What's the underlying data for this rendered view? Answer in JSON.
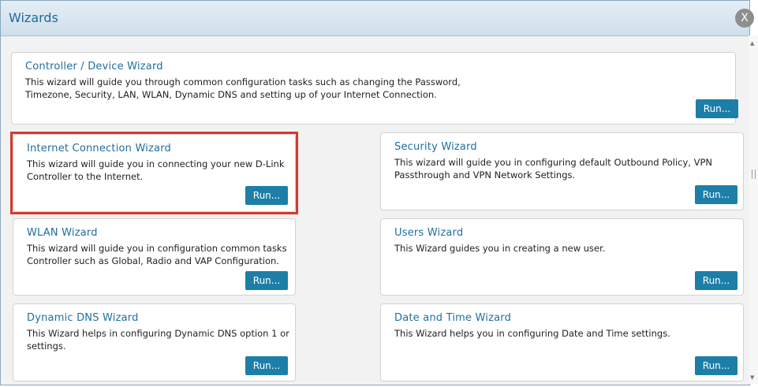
{
  "dialog": {
    "title": "Wizards",
    "close_label": "X"
  },
  "cards": {
    "controller": {
      "title": "Controller / Device Wizard",
      "desc": "This wizard will guide you through common configuration tasks such as changing the Password, Timezone, Security, LAN, WLAN, Dynamic DNS and setting up of your Internet Connection.",
      "run_label": "Run..."
    },
    "internet": {
      "title": "Internet Connection Wizard",
      "desc": "This wizard will guide you in connecting your new D-Link Controller to the Internet.",
      "run_label": "Run...",
      "highlighted": true
    },
    "security": {
      "title": "Security Wizard",
      "desc": "This wizard will guide you in configuring default Outbound Policy, VPN Passthrough and VPN Network Settings.",
      "run_label": "Run..."
    },
    "wlan": {
      "title": "WLAN Wizard",
      "desc": "This wizard will guide you in configuration common tasks Controller such as Global, Radio and VAP Configuration.",
      "run_label": "Run..."
    },
    "users": {
      "title": "Users Wizard",
      "desc": "This Wizard guides you in creating a new user.",
      "run_label": "Run..."
    },
    "ddns": {
      "title": "Dynamic DNS Wizard",
      "desc": "This Wizard helps in configuring Dynamic DNS option 1 or settings.",
      "run_label": "Run..."
    },
    "datetime": {
      "title": "Date and Time Wizard",
      "desc": "This Wizard helps you in configuring Date and Time settings.",
      "run_label": "Run..."
    }
  },
  "colors": {
    "title_text": "#1d6a98",
    "card_title": "#1f6f9f",
    "run_button": "#1d7fa8",
    "highlight": "#d23a2f"
  }
}
